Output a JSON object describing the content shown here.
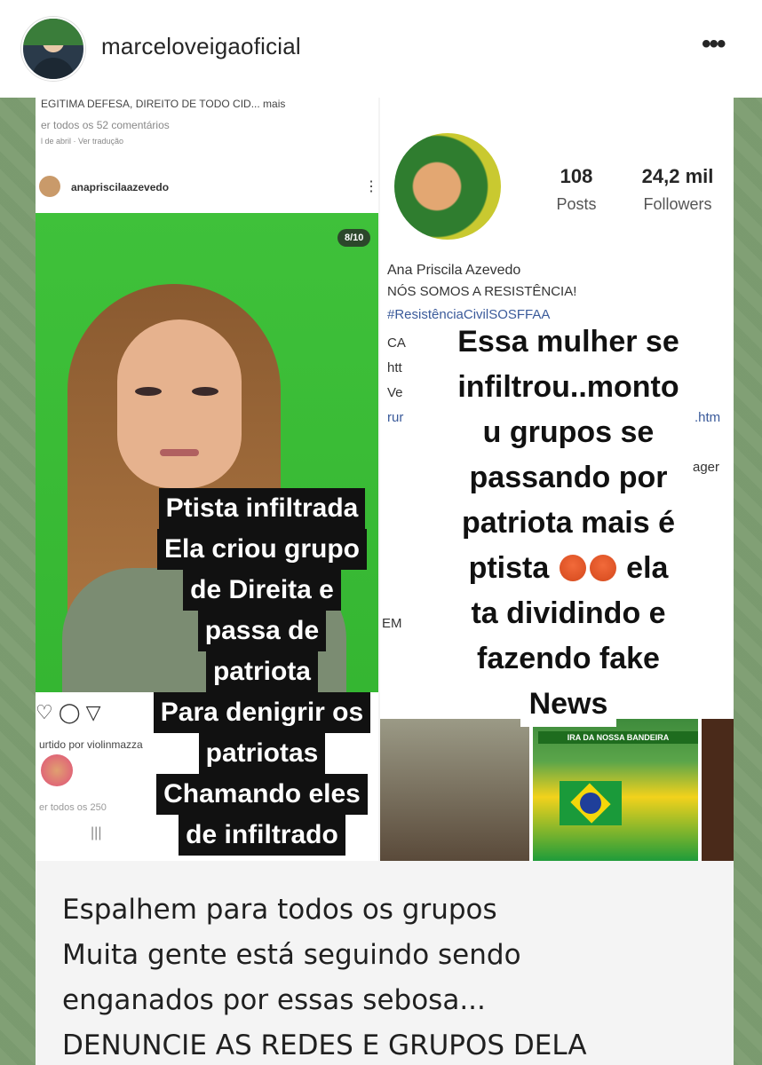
{
  "post_header": {
    "username": "marceloveigaoficial",
    "more_icon": "more-horizontal-icon"
  },
  "left_screenshot": {
    "caption_top": "EGITIMA DEFESA, DIREITO DE TODO CID... mais",
    "view_comments": "er todos os 52 comentários",
    "date": "l de abril · Ver tradução",
    "username": "anapriscilaazevedo",
    "pager": "8/10",
    "liked_by": "urtido por violinmazza",
    "view_all": "er todos os 250"
  },
  "right_screenshot": {
    "posts_count": "108",
    "posts_label": "Posts",
    "followers_count": "24,2 mil",
    "followers_label": "Followers",
    "name": "Ana Priscila Azevedo",
    "bio": "NÓS SOMOS A RESISTÊNCIA!",
    "hashtag": "#ResistênciaCivilSOSFFAA",
    "frag_ca": "CA",
    "frag_htt": "htt",
    "frag_ve": "Ve",
    "frag_rur": "rur",
    "frag_htm": ".htm",
    "frag_ager": "ager",
    "frag_em": "EM",
    "grid_title": "IRA DA NOSSA BANDEIRA"
  },
  "overlay_left": [
    "Ptista infiltrada",
    "Ela criou grupo",
    "de Direita e",
    "passa de",
    "patriota",
    "Para denigrir os",
    "patriotas",
    "Chamando eles",
    "de infiltrado"
  ],
  "overlay_right": {
    "l1": "Essa mulher se",
    "l2": "infiltrou..monto",
    "l3": "u grupos se",
    "l4": "passando por",
    "l5": "patriota mais é",
    "l6a": "ptista",
    "l6b": "ela",
    "l7": "ta dividindo e",
    "l8": "fazendo fake",
    "l9": "News",
    "emoji_icon": "angry-face-icon"
  },
  "bottom_caption": [
    "Espalhem para todos os grupos",
    "Muita gente está seguindo sendo",
    "enganados por essas sebosa...",
    "DENUNCIE AS REDES E GRUPOS DELA"
  ]
}
